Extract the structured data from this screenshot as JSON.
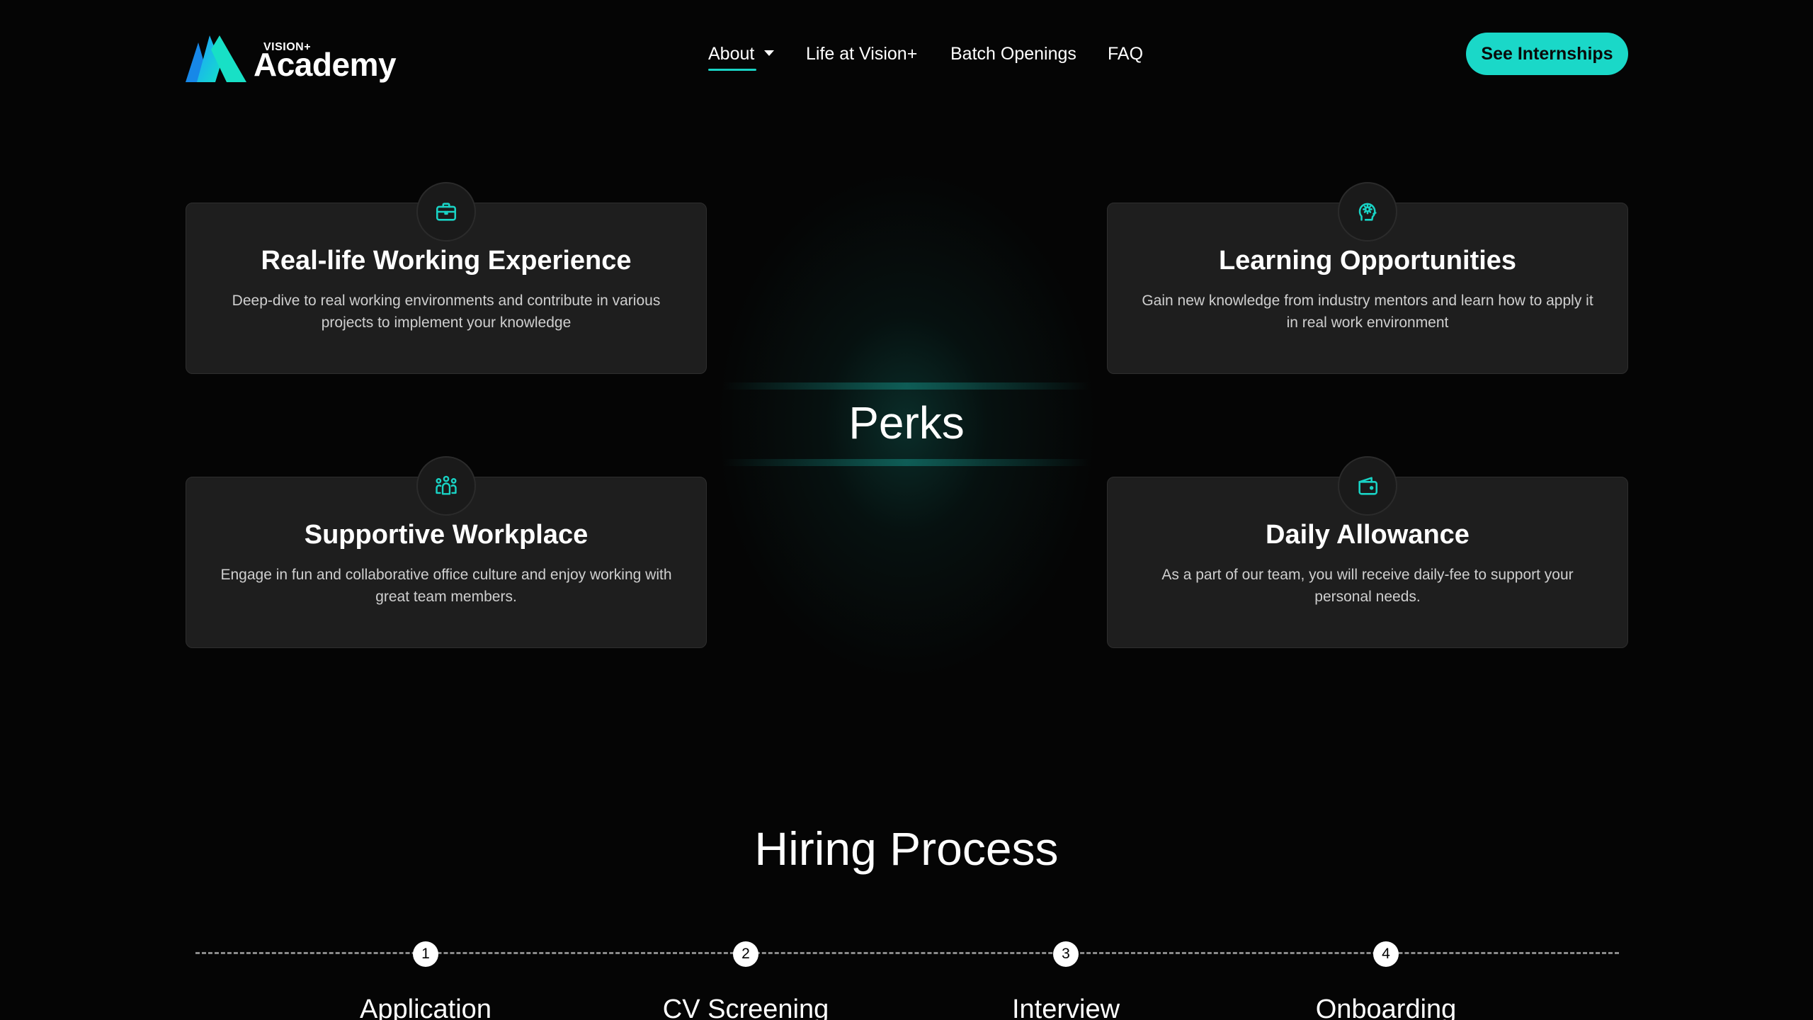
{
  "header": {
    "logo_small": "VISION+",
    "logo_big": "Academy",
    "nav": [
      {
        "label": "About",
        "has_dropdown": true,
        "active": true
      },
      {
        "label": "Life at Vision+"
      },
      {
        "label": "Batch Openings"
      },
      {
        "label": "FAQ"
      }
    ],
    "cta_label": "See Internships"
  },
  "colors": {
    "accent": "#1ad8c8",
    "background": "#050505",
    "card": "#1e1e1e"
  },
  "perks": {
    "title": "Perks",
    "cards": [
      {
        "icon": "briefcase-icon",
        "title": "Real-life Working Experience",
        "desc": "Deep-dive to real working environments and contribute in various projects to implement your knowledge"
      },
      {
        "icon": "head-gear-icon",
        "title": "Learning Opportunities",
        "desc": "Gain new knowledge from industry mentors and learn how to apply it in real work environment"
      },
      {
        "icon": "team-icon",
        "title": "Supportive Workplace",
        "desc": "Engage in fun and collaborative office culture and enjoy working with great team members."
      },
      {
        "icon": "wallet-icon",
        "title": "Daily Allowance",
        "desc": "As a part of our team, you will receive daily-fee to support your personal needs."
      }
    ]
  },
  "hiring": {
    "title": "Hiring Process",
    "steps": [
      {
        "num": "1",
        "label": "Application"
      },
      {
        "num": "2",
        "label": "CV Screening"
      },
      {
        "num": "3",
        "label": "Interview"
      },
      {
        "num": "4",
        "label": "Onboarding"
      }
    ]
  }
}
